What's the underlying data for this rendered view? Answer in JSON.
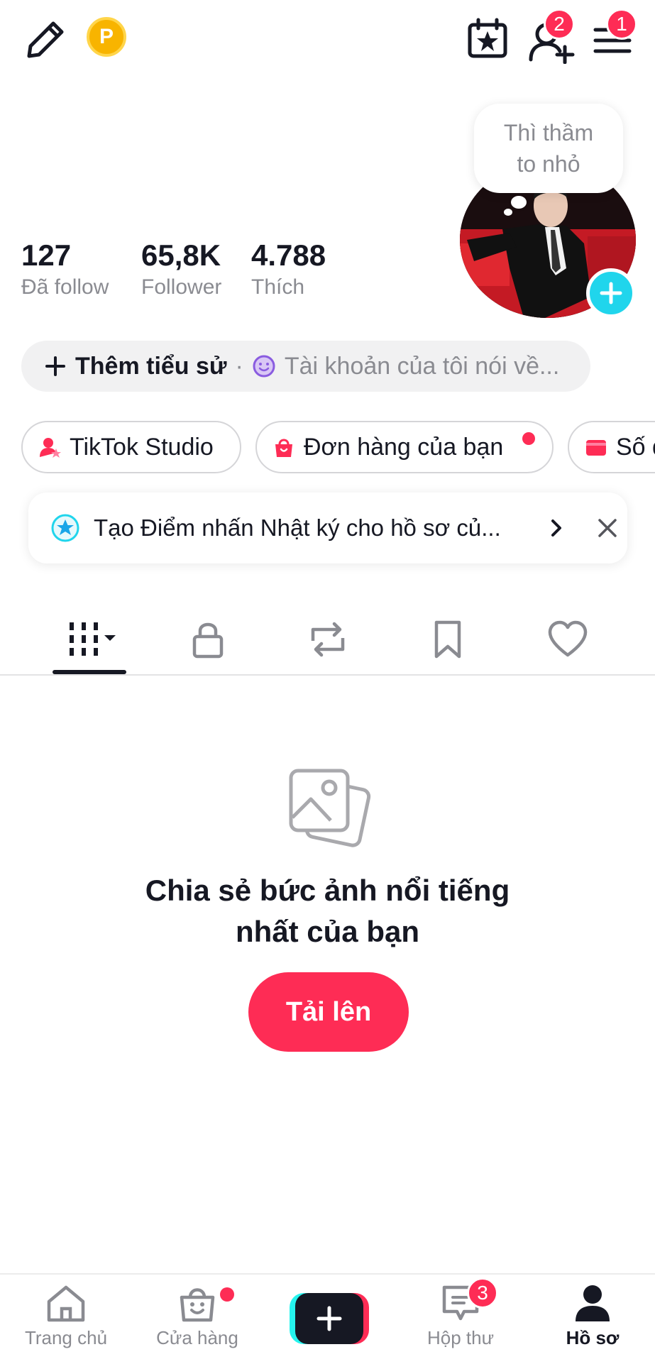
{
  "header": {
    "edit_icon": "pencil-icon",
    "coin_letter": "P",
    "calendar_icon": "calendar-star-icon",
    "add_friend_badge": "2",
    "menu_badge": "1"
  },
  "profile": {
    "bubble_line1": "Thì thầm",
    "bubble_line2": "to nhỏ",
    "stats": [
      {
        "value": "127",
        "label": "Đã follow"
      },
      {
        "value": "65,8K",
        "label": "Follower"
      },
      {
        "value": "4.788",
        "label": "Thích"
      }
    ],
    "add_bio_label": "Thêm tiểu sử",
    "bio_separator": "·",
    "bio_placeholder": "Tài khoản của tôi nói về..."
  },
  "chips": [
    {
      "label": "TikTok Studio"
    },
    {
      "label": "Đơn hàng của bạn"
    },
    {
      "label": "Số d"
    }
  ],
  "notice": {
    "text": "Tạo Điểm nhấn Nhật ký cho hồ sơ củ..."
  },
  "empty_state": {
    "line1": "Chia sẻ bức ảnh nổi tiếng",
    "line2": "nhất của bạn",
    "button": "Tải lên"
  },
  "bottom_nav": {
    "home": "Trang chủ",
    "shop": "Cửa hàng",
    "inbox": "Hộp thư",
    "inbox_badge": "3",
    "profile": "Hồ sơ"
  },
  "colors": {
    "accent": "#fe2c55",
    "cyan": "#20d5ec",
    "text": "#161823",
    "muted": "#8a8b91"
  }
}
